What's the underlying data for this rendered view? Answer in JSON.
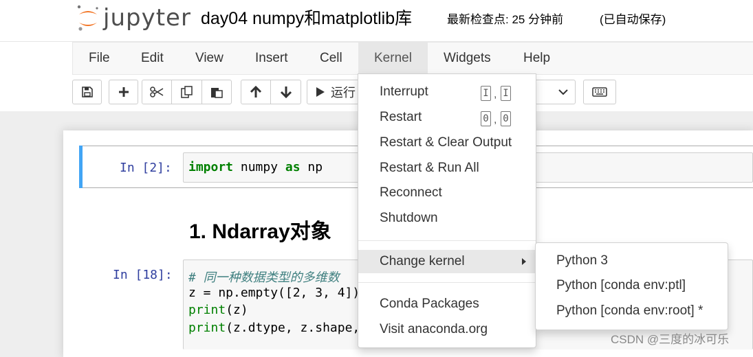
{
  "header": {
    "logo_text": "jupyter",
    "notebook_title": "day04 numpy和matplotlib库",
    "checkpoint": "最新检查点: 25 分钟前",
    "autosave": "(已自动保存)"
  },
  "menubar": {
    "items": [
      "File",
      "Edit",
      "View",
      "Insert",
      "Cell",
      "Kernel",
      "Widgets",
      "Help"
    ],
    "open_item": "Kernel"
  },
  "toolbar": {
    "run_label": "运行",
    "icons": [
      "save-icon",
      "plus-icon",
      "cut-icon",
      "copy-icon",
      "paste-icon",
      "arrow-up-icon",
      "arrow-down-icon",
      "run-icon",
      "chevron-down-icon",
      "keyboard-icon"
    ]
  },
  "cells": {
    "cell1": {
      "prompt": "In  [2]:",
      "code_kw1": "import",
      "code_mid": " numpy ",
      "code_kw2": "as",
      "code_end": " np"
    },
    "markdown_heading": "1. Ndarray对象",
    "cell2": {
      "prompt": "In  [18]:",
      "line1": "# 同一种数据类型的多维数",
      "line2": "z = np.empty([2, 3, 4])",
      "line3_fn": "print",
      "line3_rest": "(z)",
      "line4_fn": "print",
      "line4_rest": "(z.dtype, z.shape,"
    }
  },
  "kernel_menu": {
    "items": [
      {
        "label": "Interrupt",
        "shortcut": [
          "I",
          "I"
        ]
      },
      {
        "label": "Restart",
        "shortcut": [
          "0",
          "0"
        ]
      },
      {
        "label": "Restart & Clear Output"
      },
      {
        "label": "Restart & Run All"
      },
      {
        "label": "Reconnect"
      },
      {
        "label": "Shutdown"
      },
      {
        "label": "Change kernel"
      },
      {
        "label": "Conda Packages"
      },
      {
        "label": "Visit anaconda.org"
      }
    ],
    "shortcut_separator": ","
  },
  "change_kernel_submenu": {
    "items": [
      "Python 3",
      "Python [conda env:ptl]",
      "Python [conda env:root] *"
    ]
  },
  "watermark": "CSDN @三度的冰可乐",
  "colors": {
    "logo_orange": "#f37626",
    "selected_cell_bar": "#42a5f5",
    "prompt_blue": "#303f9f",
    "keyword_green": "#008000",
    "comment_teal": "#408080"
  }
}
